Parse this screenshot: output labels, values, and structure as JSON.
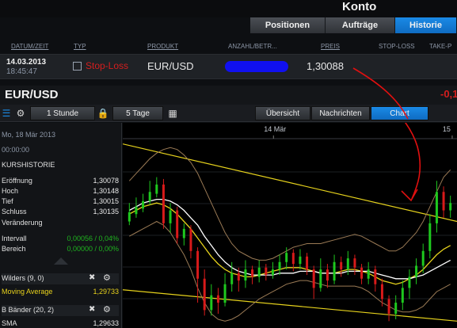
{
  "header": {
    "title": "Konto",
    "tabs": [
      {
        "label": "Positionen",
        "active": false
      },
      {
        "label": "Aufträge",
        "active": false
      },
      {
        "label": "Historie",
        "active": true
      }
    ]
  },
  "columns": {
    "date": "DATUM/ZEIT",
    "type": "TYP",
    "product": "PRODUKT",
    "amount": "ANZAHL/BETR...",
    "price": "PREIS",
    "stoploss": "STOP-LOSS",
    "takeprofit": "TAKE-P"
  },
  "order": {
    "date": "14.03.2013",
    "time": "18:45:47",
    "type": "Stop-Loss",
    "product": "EUR/USD",
    "price": "1,30088"
  },
  "instrument": {
    "name": "EUR/USD",
    "change": "-0,1"
  },
  "toolbar": {
    "interval": "1 Stunde",
    "range": "5 Tage",
    "tab_overview": "Übersicht",
    "tab_news": "Nachrichten",
    "tab_chart": "Chart"
  },
  "panel": {
    "date": "Mo, 18 Mär 2013",
    "time": "00:00:00",
    "history_title": "KURSHISTORIE",
    "open_label": "Eröffnung",
    "open_value": "1,30078",
    "high_label": "Hoch",
    "high_value": "1,30148",
    "low_label": "Tief",
    "low_value": "1,30015",
    "close_label": "Schluss",
    "close_value": "1,30135",
    "change_label": "Veränderung",
    "interval_label": "Intervall",
    "interval_value": "0,00056 / 0,04%",
    "range_label": "Bereich",
    "range_value": "0,00000 / 0,00%",
    "wilders_label": "Wilders (9, 0)",
    "ma_label": "Moving Average",
    "ma_value": "1,29733",
    "bb_label": "B Bänder (20, 2)",
    "sma_label": "SMA",
    "sma_value": "1,29633"
  },
  "chart_data": {
    "type": "candlestick",
    "x_ticks": [
      "14 Mär",
      "15"
    ],
    "candles": [
      {
        "o": 0.56,
        "c": 0.61,
        "h": 0.66,
        "l": 0.54
      },
      {
        "o": 0.6,
        "c": 0.64,
        "h": 0.69,
        "l": 0.58
      },
      {
        "o": 0.63,
        "c": 0.67,
        "h": 0.71,
        "l": 0.61
      },
      {
        "o": 0.67,
        "c": 0.72,
        "h": 0.78,
        "l": 0.65
      },
      {
        "o": 0.71,
        "c": 0.76,
        "h": 0.8,
        "l": 0.69
      },
      {
        "o": 0.76,
        "c": 0.55,
        "h": 0.79,
        "l": 0.52
      },
      {
        "o": 0.55,
        "c": 0.62,
        "h": 0.66,
        "l": 0.5
      },
      {
        "o": 0.62,
        "c": 0.47,
        "h": 0.64,
        "l": 0.44
      },
      {
        "o": 0.47,
        "c": 0.52,
        "h": 0.55,
        "l": 0.43
      },
      {
        "o": 0.52,
        "c": 0.4,
        "h": 0.54,
        "l": 0.36
      },
      {
        "o": 0.4,
        "c": 0.25,
        "h": 0.42,
        "l": 0.12
      },
      {
        "o": 0.25,
        "c": 0.08,
        "h": 0.3,
        "l": 0.05
      },
      {
        "o": 0.08,
        "c": 0.16,
        "h": 0.22,
        "l": 0.05
      },
      {
        "o": 0.16,
        "c": 0.12,
        "h": 0.2,
        "l": 0.06
      },
      {
        "o": 0.12,
        "c": 0.22,
        "h": 0.28,
        "l": 0.1
      },
      {
        "o": 0.22,
        "c": 0.28,
        "h": 0.34,
        "l": 0.18
      },
      {
        "o": 0.28,
        "c": 0.24,
        "h": 0.31,
        "l": 0.18
      },
      {
        "o": 0.24,
        "c": 0.3,
        "h": 0.35,
        "l": 0.2
      },
      {
        "o": 0.3,
        "c": 0.26,
        "h": 0.32,
        "l": 0.22
      },
      {
        "o": 0.26,
        "c": 0.31,
        "h": 0.35,
        "l": 0.23
      },
      {
        "o": 0.31,
        "c": 0.27,
        "h": 0.33,
        "l": 0.24
      },
      {
        "o": 0.27,
        "c": 0.3,
        "h": 0.34,
        "l": 0.25
      },
      {
        "o": 0.3,
        "c": 0.34,
        "h": 0.38,
        "l": 0.27
      },
      {
        "o": 0.34,
        "c": 0.39,
        "h": 0.42,
        "l": 0.3
      },
      {
        "o": 0.39,
        "c": 0.33,
        "h": 0.41,
        "l": 0.29
      },
      {
        "o": 0.33,
        "c": 0.37,
        "h": 0.41,
        "l": 0.3
      },
      {
        "o": 0.37,
        "c": 0.3,
        "h": 0.39,
        "l": 0.27
      },
      {
        "o": 0.3,
        "c": 0.2,
        "h": 0.32,
        "l": 0.14
      },
      {
        "o": 0.2,
        "c": 0.3,
        "h": 0.36,
        "l": 0.18
      },
      {
        "o": 0.3,
        "c": 0.24,
        "h": 0.33,
        "l": 0.2
      },
      {
        "o": 0.24,
        "c": 0.34,
        "h": 0.38,
        "l": 0.22
      },
      {
        "o": 0.34,
        "c": 0.3,
        "h": 0.37,
        "l": 0.26
      },
      {
        "o": 0.3,
        "c": 0.36,
        "h": 0.4,
        "l": 0.27
      },
      {
        "o": 0.36,
        "c": 0.31,
        "h": 0.38,
        "l": 0.27
      },
      {
        "o": 0.31,
        "c": 0.25,
        "h": 0.33,
        "l": 0.22
      },
      {
        "o": 0.25,
        "c": 0.3,
        "h": 0.34,
        "l": 0.22
      },
      {
        "o": 0.3,
        "c": 0.22,
        "h": 0.32,
        "l": 0.18
      },
      {
        "o": 0.22,
        "c": 0.14,
        "h": 0.25,
        "l": 0.1
      },
      {
        "o": 0.14,
        "c": 0.06,
        "h": 0.16,
        "l": 0.02
      },
      {
        "o": 0.06,
        "c": 0.12,
        "h": 0.16,
        "l": 0.03
      },
      {
        "o": 0.12,
        "c": 0.2,
        "h": 0.24,
        "l": 0.08
      },
      {
        "o": 0.2,
        "c": 0.26,
        "h": 0.3,
        "l": 0.14
      },
      {
        "o": 0.26,
        "c": 0.32,
        "h": 0.36,
        "l": 0.22
      },
      {
        "o": 0.32,
        "c": 0.4,
        "h": 0.44,
        "l": 0.28
      },
      {
        "o": 0.4,
        "c": 0.55,
        "h": 0.6,
        "l": 0.36
      },
      {
        "o": 0.55,
        "c": 0.72,
        "h": 0.78,
        "l": 0.5
      },
      {
        "o": 0.72,
        "c": 0.62,
        "h": 0.75,
        "l": 0.58
      },
      {
        "o": 0.62,
        "c": 0.66,
        "h": 0.7,
        "l": 0.58
      }
    ],
    "bb_upper": [
      0.78,
      0.82,
      0.86,
      0.9,
      0.93,
      0.95,
      0.96,
      0.95,
      0.92,
      0.88,
      0.82,
      0.74,
      0.66,
      0.58,
      0.5,
      0.44,
      0.4,
      0.38,
      0.36,
      0.35,
      0.35,
      0.36,
      0.38,
      0.4,
      0.42,
      0.43,
      0.44,
      0.44,
      0.44,
      0.45,
      0.46,
      0.47,
      0.48,
      0.49,
      0.48,
      0.46,
      0.44,
      0.42,
      0.4,
      0.4,
      0.42,
      0.46,
      0.5,
      0.56,
      0.64,
      0.72,
      0.8,
      0.84
    ],
    "bb_lower": [
      0.48,
      0.5,
      0.52,
      0.54,
      0.56,
      0.54,
      0.5,
      0.44,
      0.38,
      0.3,
      0.2,
      0.12,
      0.06,
      0.03,
      0.02,
      0.03,
      0.05,
      0.08,
      0.11,
      0.14,
      0.16,
      0.18,
      0.2,
      0.22,
      0.23,
      0.24,
      0.24,
      0.23,
      0.22,
      0.21,
      0.21,
      0.21,
      0.21,
      0.21,
      0.2,
      0.18,
      0.15,
      0.12,
      0.1,
      0.08,
      0.07,
      0.07,
      0.08,
      0.1,
      0.14,
      0.18,
      0.2,
      0.22
    ],
    "ma_white": [
      0.62,
      0.64,
      0.66,
      0.67,
      0.68,
      0.68,
      0.67,
      0.65,
      0.62,
      0.58,
      0.54,
      0.48,
      0.43,
      0.38,
      0.34,
      0.31,
      0.29,
      0.28,
      0.27,
      0.27,
      0.27,
      0.27,
      0.28,
      0.28,
      0.28,
      0.29,
      0.29,
      0.29,
      0.28,
      0.28,
      0.28,
      0.28,
      0.29,
      0.29,
      0.29,
      0.29,
      0.28,
      0.27,
      0.26,
      0.25,
      0.25,
      0.25,
      0.26,
      0.27,
      0.29,
      0.31,
      0.33,
      0.35
    ],
    "ma_yellow": [
      0.6,
      0.62,
      0.64,
      0.65,
      0.66,
      0.65,
      0.63,
      0.6,
      0.56,
      0.52,
      0.47,
      0.42,
      0.37,
      0.33,
      0.3,
      0.28,
      0.27,
      0.26,
      0.26,
      0.27,
      0.28,
      0.29,
      0.3,
      0.31,
      0.31,
      0.31,
      0.3,
      0.29,
      0.28,
      0.28,
      0.28,
      0.29,
      0.3,
      0.3,
      0.29,
      0.28,
      0.26,
      0.24,
      0.23,
      0.22,
      0.23,
      0.25,
      0.27,
      0.3,
      0.34,
      0.38,
      0.41,
      0.43
    ],
    "trendlines": [
      {
        "from": [
          0,
          0.98
        ],
        "to": [
          1,
          0.56
        ]
      },
      {
        "from": [
          0,
          0.19
        ],
        "to": [
          1,
          0.02
        ]
      }
    ],
    "colors": {
      "up": "#1ec81e",
      "down": "#d81a1a",
      "band": "#9a7a55",
      "ma_white": "#ffffff",
      "ma_yellow": "#e6d21c",
      "trend": "#e6d21c",
      "annotation": "#e01010"
    }
  }
}
